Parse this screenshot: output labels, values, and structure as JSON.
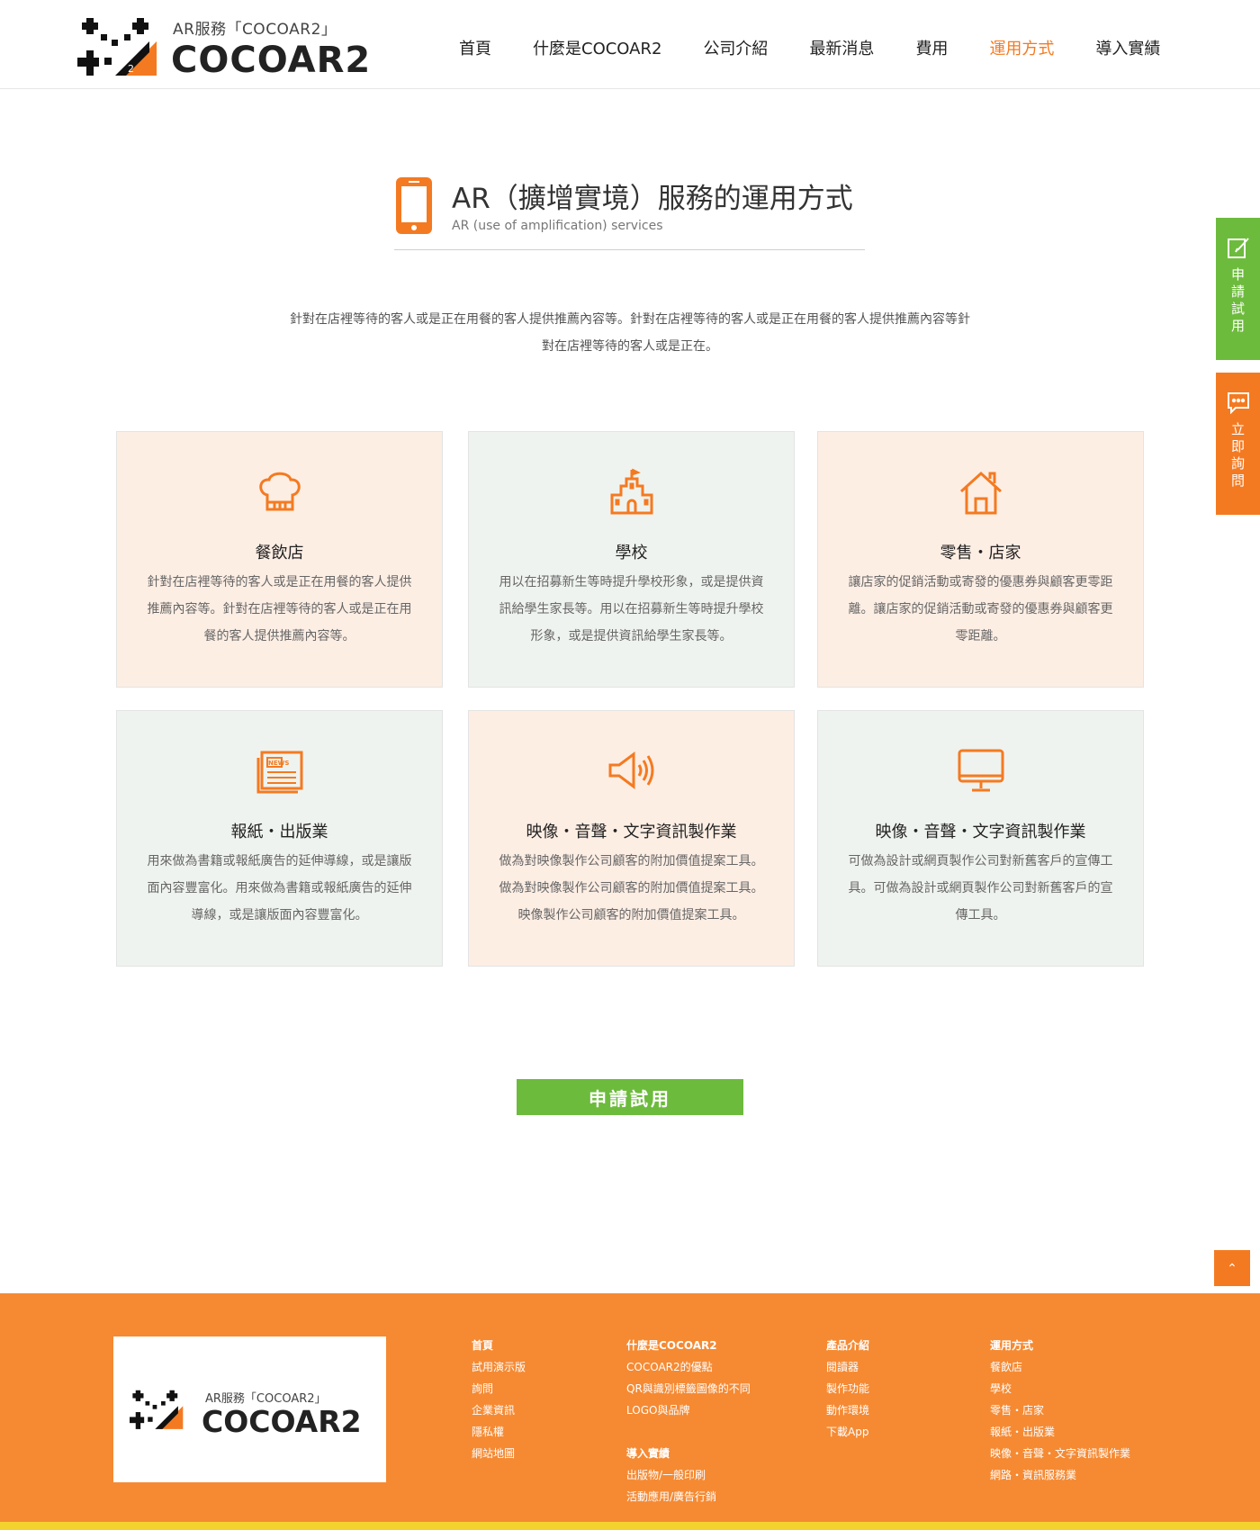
{
  "header": {
    "logo_sub": "AR服務「COCOAR2」",
    "logo_main": "COCOAR2",
    "nav": [
      "首頁",
      "什麼是COCOAR2",
      "公司介紹",
      "最新消息",
      "費用",
      "運用方式",
      "導入實績"
    ],
    "active_nav": "運用方式"
  },
  "section": {
    "title": "AR（擴增實境）服務的運用方式",
    "subtitle": "AR (use of amplification) services",
    "intro": "針對在店裡等待的客人或是正在用餐的客人提供推薦內容等。針對在店裡等待的客人或是正在用餐的客人提供推薦內容等針對在店裡等待的客人或是正在。"
  },
  "cards": [
    {
      "icon": "chef-hat-icon",
      "title": "餐飲店",
      "desc": "針對在店裡等待的客人或是正在用餐的客人提供推薦內容等。針對在店裡等待的客人或是正在用餐的客人提供推薦內容等。"
    },
    {
      "icon": "school-building-icon",
      "title": "學校",
      "desc": "用以在招募新生等時提升學校形象，或是提供資訊給學生家長等。用以在招募新生等時提升學校形象，或是提供資訊給學生家長等。"
    },
    {
      "icon": "house-icon",
      "title": "零售・店家",
      "desc": "讓店家的促銷活動或寄發的優惠券與顧客更零距離。讓店家的促銷活動或寄發的優惠券與顧客更零距離。"
    },
    {
      "icon": "newspaper-icon",
      "title": "報紙・出版業",
      "desc": "用來做為書籍或報紙廣告的延伸導線，或是讓版面內容豐富化。用來做為書籍或報紙廣告的延伸導線，或是讓版面內容豐富化。"
    },
    {
      "icon": "speaker-icon",
      "title": "映像・音聲・文字資訊製作業",
      "desc": "做為對映像製作公司顧客的附加價值提案工具。做為對映像製作公司顧客的附加價值提案工具。映像製作公司顧客的附加價值提案工具。"
    },
    {
      "icon": "monitor-icon",
      "title": "映像・音聲・文字資訊製作業",
      "desc": "可做為設計或網頁製作公司對新舊客戶的宣傳工具。可做為設計或網頁製作公司對新舊客戶的宣傳工具。"
    }
  ],
  "cta_label": "申請試用",
  "side_tabs": {
    "trial": "申請試用",
    "inquiry": "立即詢問"
  },
  "scroll_top_label": "⌃",
  "footer": {
    "logo_sub": "AR服務「COCOAR2」",
    "logo_main": "COCOAR2",
    "col1": {
      "head": "首頁",
      "links": [
        "試用演示版",
        "詢問",
        "企業資訊",
        "隱私權",
        "網站地圖"
      ]
    },
    "col2": {
      "head": "什麼是COCOAR2",
      "links": [
        "COCOAR2的優點",
        "QR與識別標籤圖像的不同",
        "LOGO與品牌"
      ],
      "head2": "導入實績",
      "links2": [
        "出版物/一般印刷",
        "活動應用/廣告行銷"
      ]
    },
    "col3": {
      "head": "產品介紹",
      "links": [
        "閱讀器",
        "製作功能",
        "動作環境",
        "下載App"
      ]
    },
    "col4": {
      "head": "運用方式",
      "links": [
        "餐飲店",
        "學校",
        "零售・店家",
        "報紙・出版業",
        "映像・音聲・文字資訊製作業",
        "網路・資訊服務業"
      ]
    }
  },
  "colors": {
    "accent": "#f47a21",
    "green": "#6dbb3d",
    "footer": "#f58a33",
    "footer_bar": "#f4d22e",
    "card_peach": "#fdeee4",
    "card_gray": "#eff3ef"
  }
}
